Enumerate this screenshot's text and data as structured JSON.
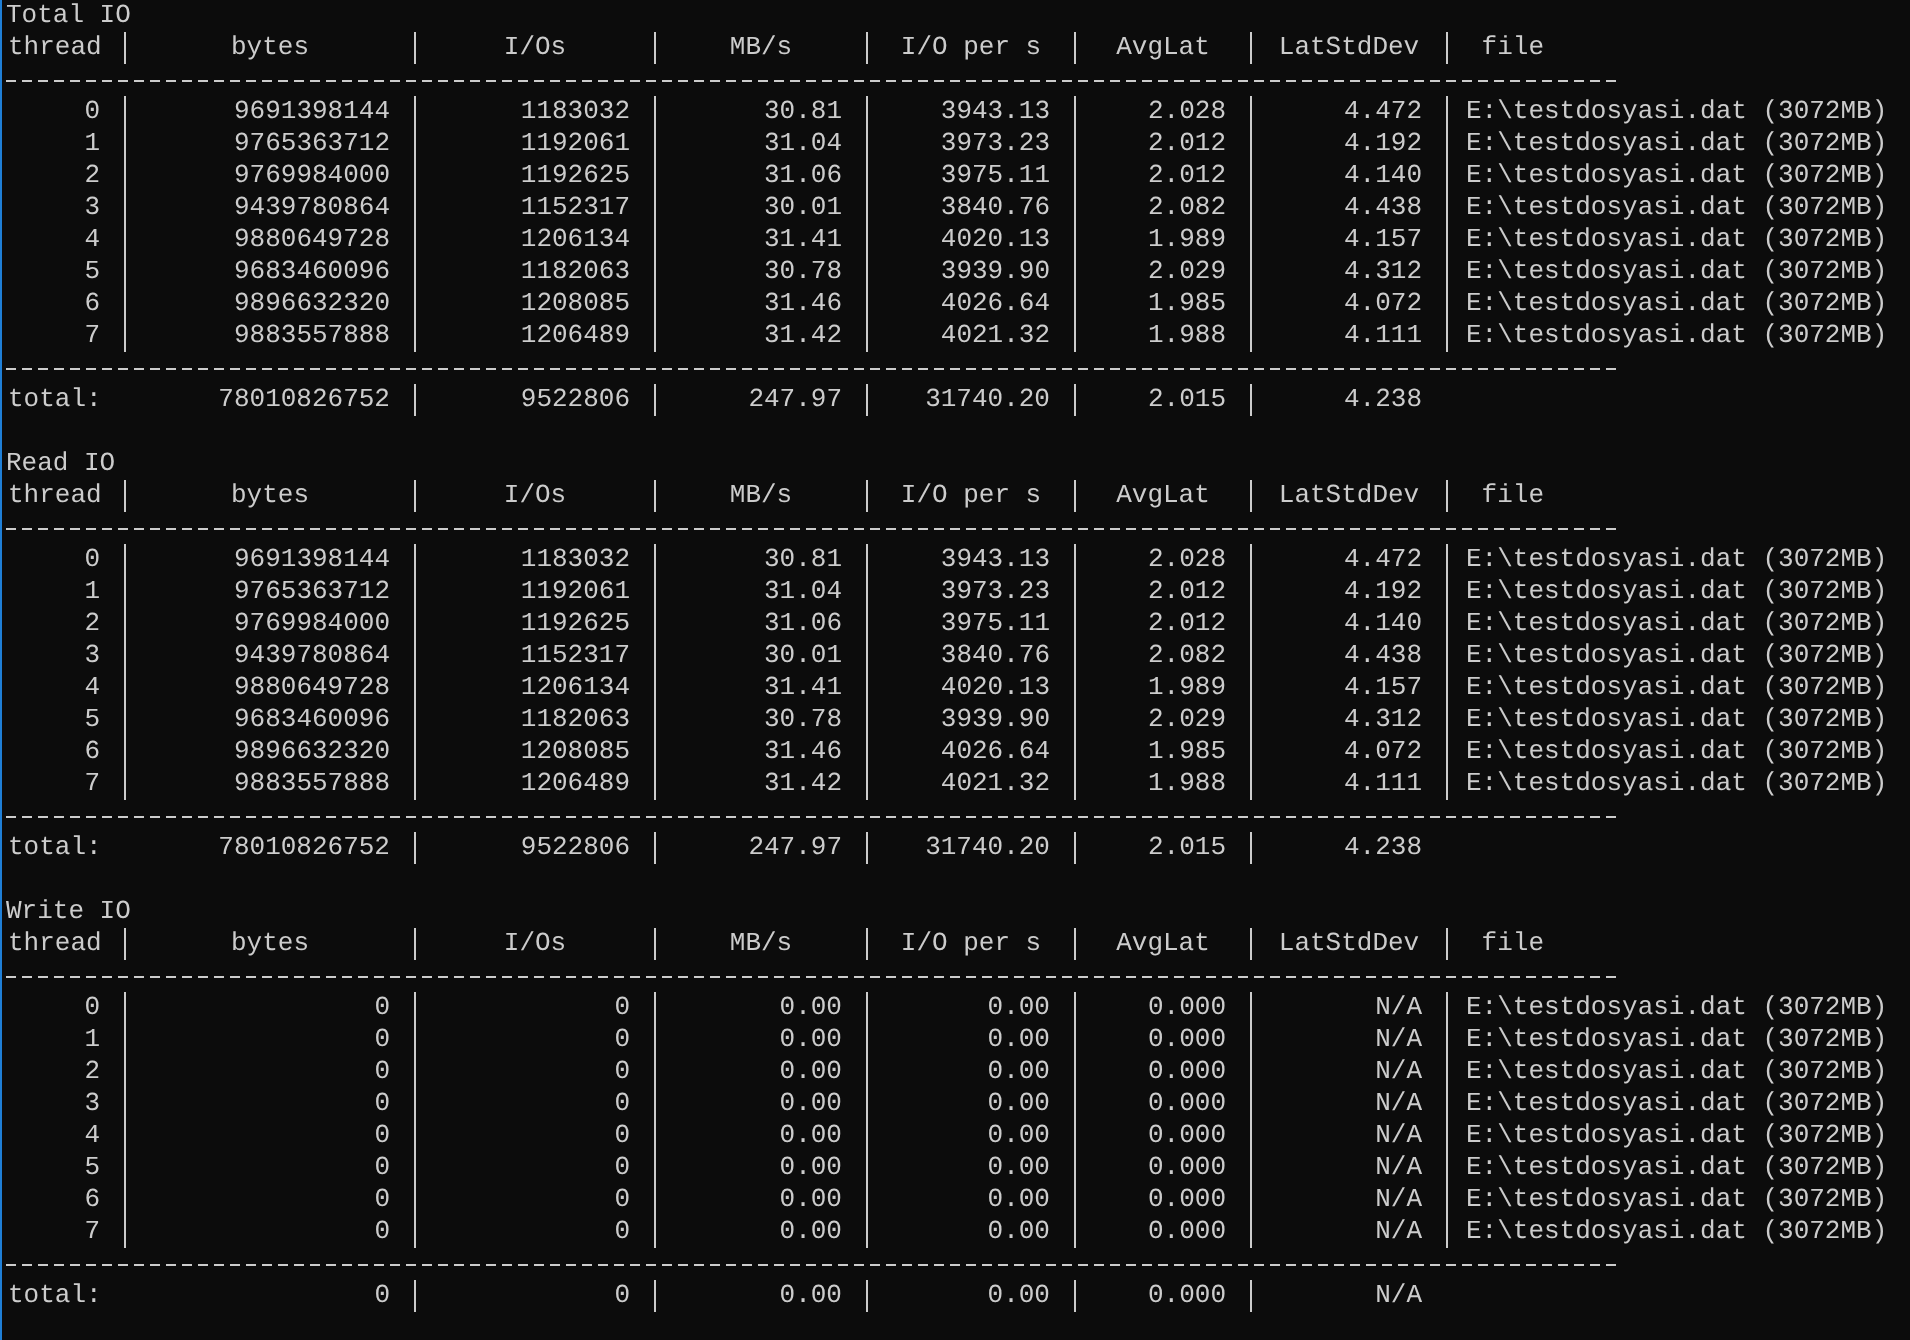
{
  "sections": [
    {
      "title": "Total IO",
      "columns": [
        "thread",
        "bytes",
        "I/Os",
        "MB/s",
        "I/O per s",
        "AvgLat",
        "LatStdDev",
        "file"
      ],
      "rows": [
        [
          "0",
          "9691398144",
          "1183032",
          "30.81",
          "3943.13",
          "2.028",
          "4.472",
          "E:\\testdosyasi.dat (3072MB)"
        ],
        [
          "1",
          "9765363712",
          "1192061",
          "31.04",
          "3973.23",
          "2.012",
          "4.192",
          "E:\\testdosyasi.dat (3072MB)"
        ],
        [
          "2",
          "9769984000",
          "1192625",
          "31.06",
          "3975.11",
          "2.012",
          "4.140",
          "E:\\testdosyasi.dat (3072MB)"
        ],
        [
          "3",
          "9439780864",
          "1152317",
          "30.01",
          "3840.76",
          "2.082",
          "4.438",
          "E:\\testdosyasi.dat (3072MB)"
        ],
        [
          "4",
          "9880649728",
          "1206134",
          "31.41",
          "4020.13",
          "1.989",
          "4.157",
          "E:\\testdosyasi.dat (3072MB)"
        ],
        [
          "5",
          "9683460096",
          "1182063",
          "30.78",
          "3939.90",
          "2.029",
          "4.312",
          "E:\\testdosyasi.dat (3072MB)"
        ],
        [
          "6",
          "9896632320",
          "1208085",
          "31.46",
          "4026.64",
          "1.985",
          "4.072",
          "E:\\testdosyasi.dat (3072MB)"
        ],
        [
          "7",
          "9883557888",
          "1206489",
          "31.42",
          "4021.32",
          "1.988",
          "4.111",
          "E:\\testdosyasi.dat (3072MB)"
        ]
      ],
      "total": {
        "label": "total:",
        "values": [
          "78010826752",
          "9522806",
          "247.97",
          "31740.20",
          "2.015",
          "4.238"
        ]
      }
    },
    {
      "title": "Read IO",
      "columns": [
        "thread",
        "bytes",
        "I/Os",
        "MB/s",
        "I/O per s",
        "AvgLat",
        "LatStdDev",
        "file"
      ],
      "rows": [
        [
          "0",
          "9691398144",
          "1183032",
          "30.81",
          "3943.13",
          "2.028",
          "4.472",
          "E:\\testdosyasi.dat (3072MB)"
        ],
        [
          "1",
          "9765363712",
          "1192061",
          "31.04",
          "3973.23",
          "2.012",
          "4.192",
          "E:\\testdosyasi.dat (3072MB)"
        ],
        [
          "2",
          "9769984000",
          "1192625",
          "31.06",
          "3975.11",
          "2.012",
          "4.140",
          "E:\\testdosyasi.dat (3072MB)"
        ],
        [
          "3",
          "9439780864",
          "1152317",
          "30.01",
          "3840.76",
          "2.082",
          "4.438",
          "E:\\testdosyasi.dat (3072MB)"
        ],
        [
          "4",
          "9880649728",
          "1206134",
          "31.41",
          "4020.13",
          "1.989",
          "4.157",
          "E:\\testdosyasi.dat (3072MB)"
        ],
        [
          "5",
          "9683460096",
          "1182063",
          "30.78",
          "3939.90",
          "2.029",
          "4.312",
          "E:\\testdosyasi.dat (3072MB)"
        ],
        [
          "6",
          "9896632320",
          "1208085",
          "31.46",
          "4026.64",
          "1.985",
          "4.072",
          "E:\\testdosyasi.dat (3072MB)"
        ],
        [
          "7",
          "9883557888",
          "1206489",
          "31.42",
          "4021.32",
          "1.988",
          "4.111",
          "E:\\testdosyasi.dat (3072MB)"
        ]
      ],
      "total": {
        "label": "total:",
        "values": [
          "78010826752",
          "9522806",
          "247.97",
          "31740.20",
          "2.015",
          "4.238"
        ]
      }
    },
    {
      "title": "Write IO",
      "columns": [
        "thread",
        "bytes",
        "I/Os",
        "MB/s",
        "I/O per s",
        "AvgLat",
        "LatStdDev",
        "file"
      ],
      "rows": [
        [
          "0",
          "0",
          "0",
          "0.00",
          "0.00",
          "0.000",
          "N/A",
          "E:\\testdosyasi.dat (3072MB)"
        ],
        [
          "1",
          "0",
          "0",
          "0.00",
          "0.00",
          "0.000",
          "N/A",
          "E:\\testdosyasi.dat (3072MB)"
        ],
        [
          "2",
          "0",
          "0",
          "0.00",
          "0.00",
          "0.000",
          "N/A",
          "E:\\testdosyasi.dat (3072MB)"
        ],
        [
          "3",
          "0",
          "0",
          "0.00",
          "0.00",
          "0.000",
          "N/A",
          "E:\\testdosyasi.dat (3072MB)"
        ],
        [
          "4",
          "0",
          "0",
          "0.00",
          "0.00",
          "0.000",
          "N/A",
          "E:\\testdosyasi.dat (3072MB)"
        ],
        [
          "5",
          "0",
          "0",
          "0.00",
          "0.00",
          "0.000",
          "N/A",
          "E:\\testdosyasi.dat (3072MB)"
        ],
        [
          "6",
          "0",
          "0",
          "0.00",
          "0.00",
          "0.000",
          "N/A",
          "E:\\testdosyasi.dat (3072MB)"
        ],
        [
          "7",
          "0",
          "0",
          "0.00",
          "0.00",
          "0.000",
          "N/A",
          "E:\\testdosyasi.dat (3072MB)"
        ]
      ],
      "total": {
        "label": "total:",
        "values": [
          "0",
          "0",
          "0.00",
          "0.00",
          "0.000",
          "N/A"
        ]
      }
    }
  ]
}
